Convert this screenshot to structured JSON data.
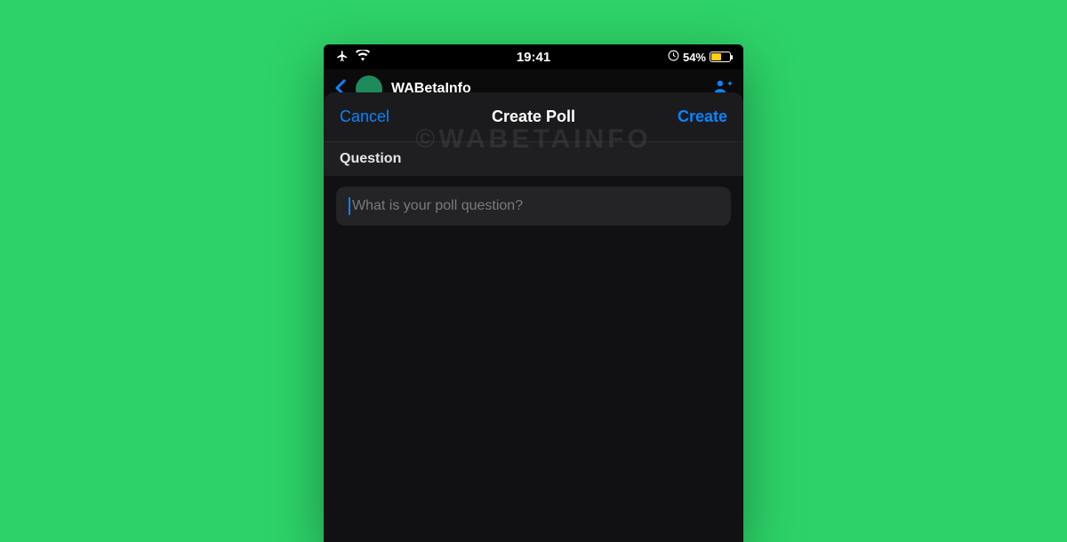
{
  "status": {
    "time": "19:41",
    "battery_pct": "54%",
    "battery_fill_pct": 54
  },
  "chat": {
    "title": "WABetaInfo"
  },
  "sheet": {
    "cancel_label": "Cancel",
    "title": "Create Poll",
    "create_label": "Create",
    "section_label": "Question",
    "input_placeholder": "What is your poll question?",
    "input_value": ""
  },
  "watermark": "©WABETAINFO",
  "icons": {
    "airplane": "✈",
    "add_contact": "➕"
  },
  "colors": {
    "accent": "#0a84ff",
    "bg_page": "#2dd268",
    "battery_fill": "#ffcf0f"
  }
}
